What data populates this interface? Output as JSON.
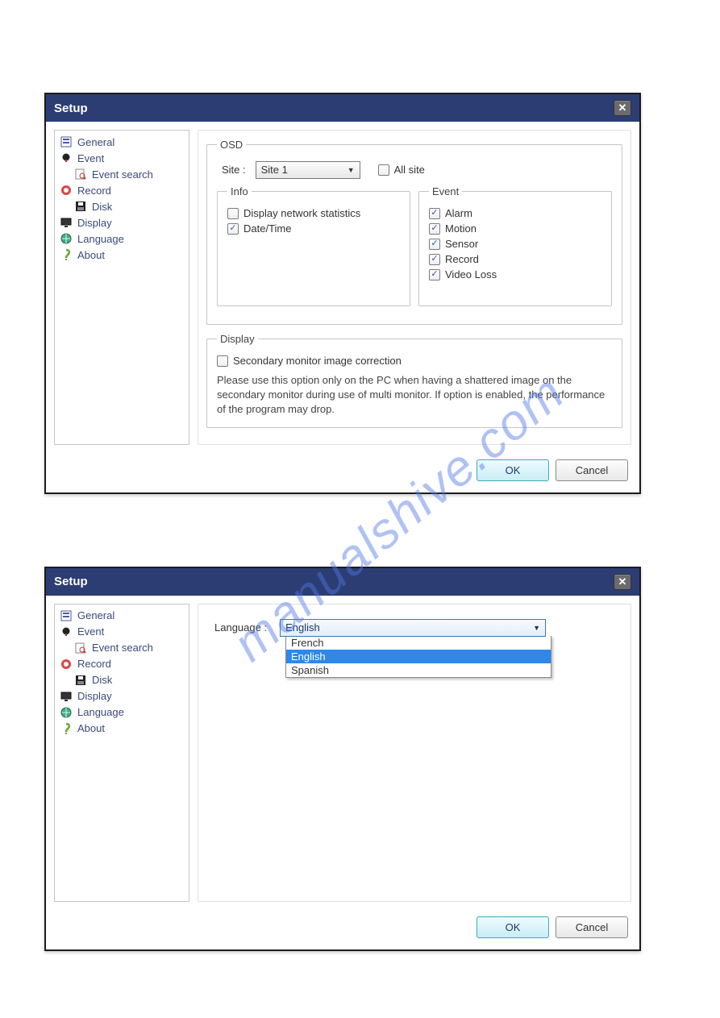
{
  "watermark": "manualshive.com",
  "common": {
    "title": "Setup",
    "ok": "OK",
    "cancel": "Cancel",
    "tree": {
      "general": "General",
      "event": "Event",
      "event_search": "Event search",
      "record": "Record",
      "disk": "Disk",
      "display": "Display",
      "language": "Language",
      "about": "About"
    }
  },
  "win1": {
    "osd": {
      "legend": "OSD",
      "site_label": "Site :",
      "site_value": "Site 1",
      "all_site": "All site",
      "info": {
        "legend": "Info",
        "network_stats": "Display network statistics",
        "datetime": "Date/Time"
      },
      "event": {
        "legend": "Event",
        "alarm": "Alarm",
        "motion": "Motion",
        "sensor": "Sensor",
        "record": "Record",
        "videoloss": "Video Loss"
      }
    },
    "display": {
      "legend": "Display",
      "secondary": "Secondary monitor image correction",
      "note": "Please use this option only on the PC when having a shattered image on the secondary monitor during use of multi monitor. If option is enabled, the performance of the program may drop."
    }
  },
  "win2": {
    "lang_label": "Language :",
    "selected": "English",
    "options": {
      "french": "French",
      "english": "English",
      "spanish": "Spanish"
    }
  }
}
